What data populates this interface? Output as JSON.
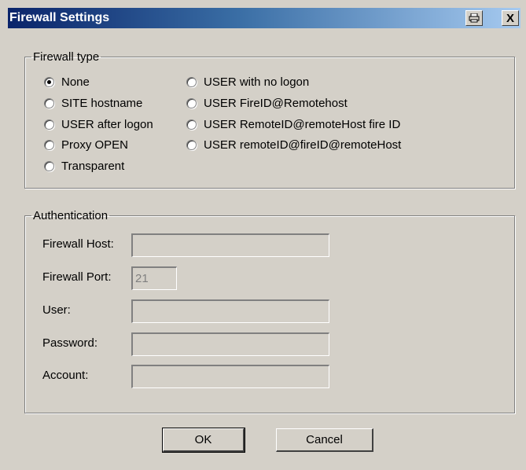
{
  "window": {
    "title": "Firewall Settings",
    "print_icon": "printer-icon",
    "close_label": "X"
  },
  "firewall_type": {
    "legend": "Firewall type",
    "options_col1": [
      "None",
      "SITE hostname",
      "USER after logon",
      "Proxy OPEN",
      "Transparent"
    ],
    "options_col2": [
      "USER with no logon",
      "USER FireID@Remotehost",
      "USER RemoteID@remoteHost fire ID",
      "USER remoteID@fireID@remoteHost"
    ],
    "selected": "None"
  },
  "authentication": {
    "legend": "Authentication",
    "fields": {
      "host": {
        "label": "Firewall Host:",
        "value": ""
      },
      "port": {
        "label": "Firewall Port:",
        "value": "21"
      },
      "user": {
        "label": "User:",
        "value": ""
      },
      "password": {
        "label": "Password:",
        "value": ""
      },
      "account": {
        "label": "Account:",
        "value": ""
      }
    }
  },
  "buttons": {
    "ok": "OK",
    "cancel": "Cancel"
  }
}
